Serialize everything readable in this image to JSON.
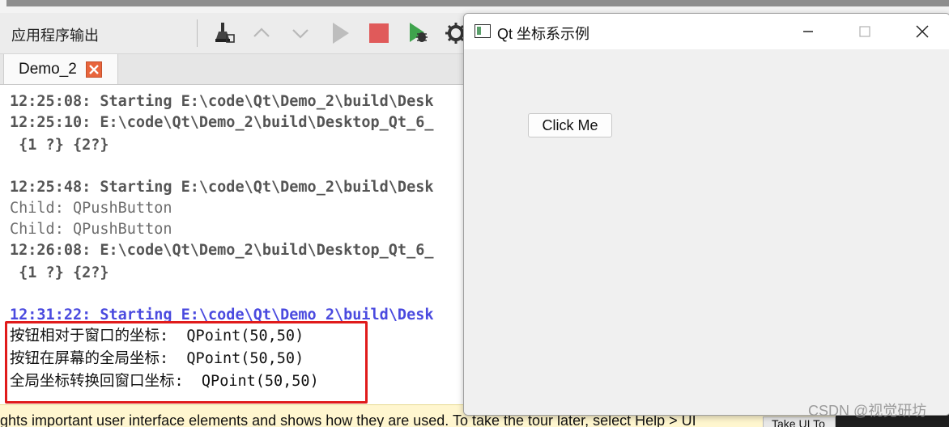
{
  "output_pane": {
    "title": "应用程序输出",
    "toolbar_icons": [
      "clean-icon",
      "up-arrow-icon",
      "down-arrow-icon",
      "run-icon",
      "stop-icon",
      "debug-run-icon",
      "settings-icon"
    ],
    "tab": {
      "label": "Demo_2"
    },
    "lines": [
      "12:25:08: Starting E:\\code\\Qt\\Demo_2\\build\\Desk",
      "12:25:10: E:\\code\\Qt\\Demo_2\\build\\Desktop_Qt_6_",
      " {1 ?} {2?}",
      "12:25:48: Starting E:\\code\\Qt\\Demo_2\\build\\Desk",
      "Child: QPushButton",
      "Child: QPushButton",
      "12:26:08: E:\\code\\Qt\\Demo_2\\build\\Desktop_Qt_6_",
      " {1 ?} {2?}",
      "12:31:22: Starting E:\\code\\Qt\\Demo_2\\build\\Desk",
      "按钮相对于窗口的坐标:  QPoint(50,50)",
      "按钮在屏幕的全局坐标:  QPoint(50,50)",
      "全局坐标转换回窗口坐标:  QPoint(50,50)"
    ]
  },
  "qt_window": {
    "title": "Qt 坐标系示例",
    "button_label": "Click Me"
  },
  "banner": {
    "text": "ghts important user interface elements and shows how they are used. To take the tour later, select Help > UI",
    "button_label": "Take UI To"
  },
  "watermark": "CSDN @视觉研坊"
}
